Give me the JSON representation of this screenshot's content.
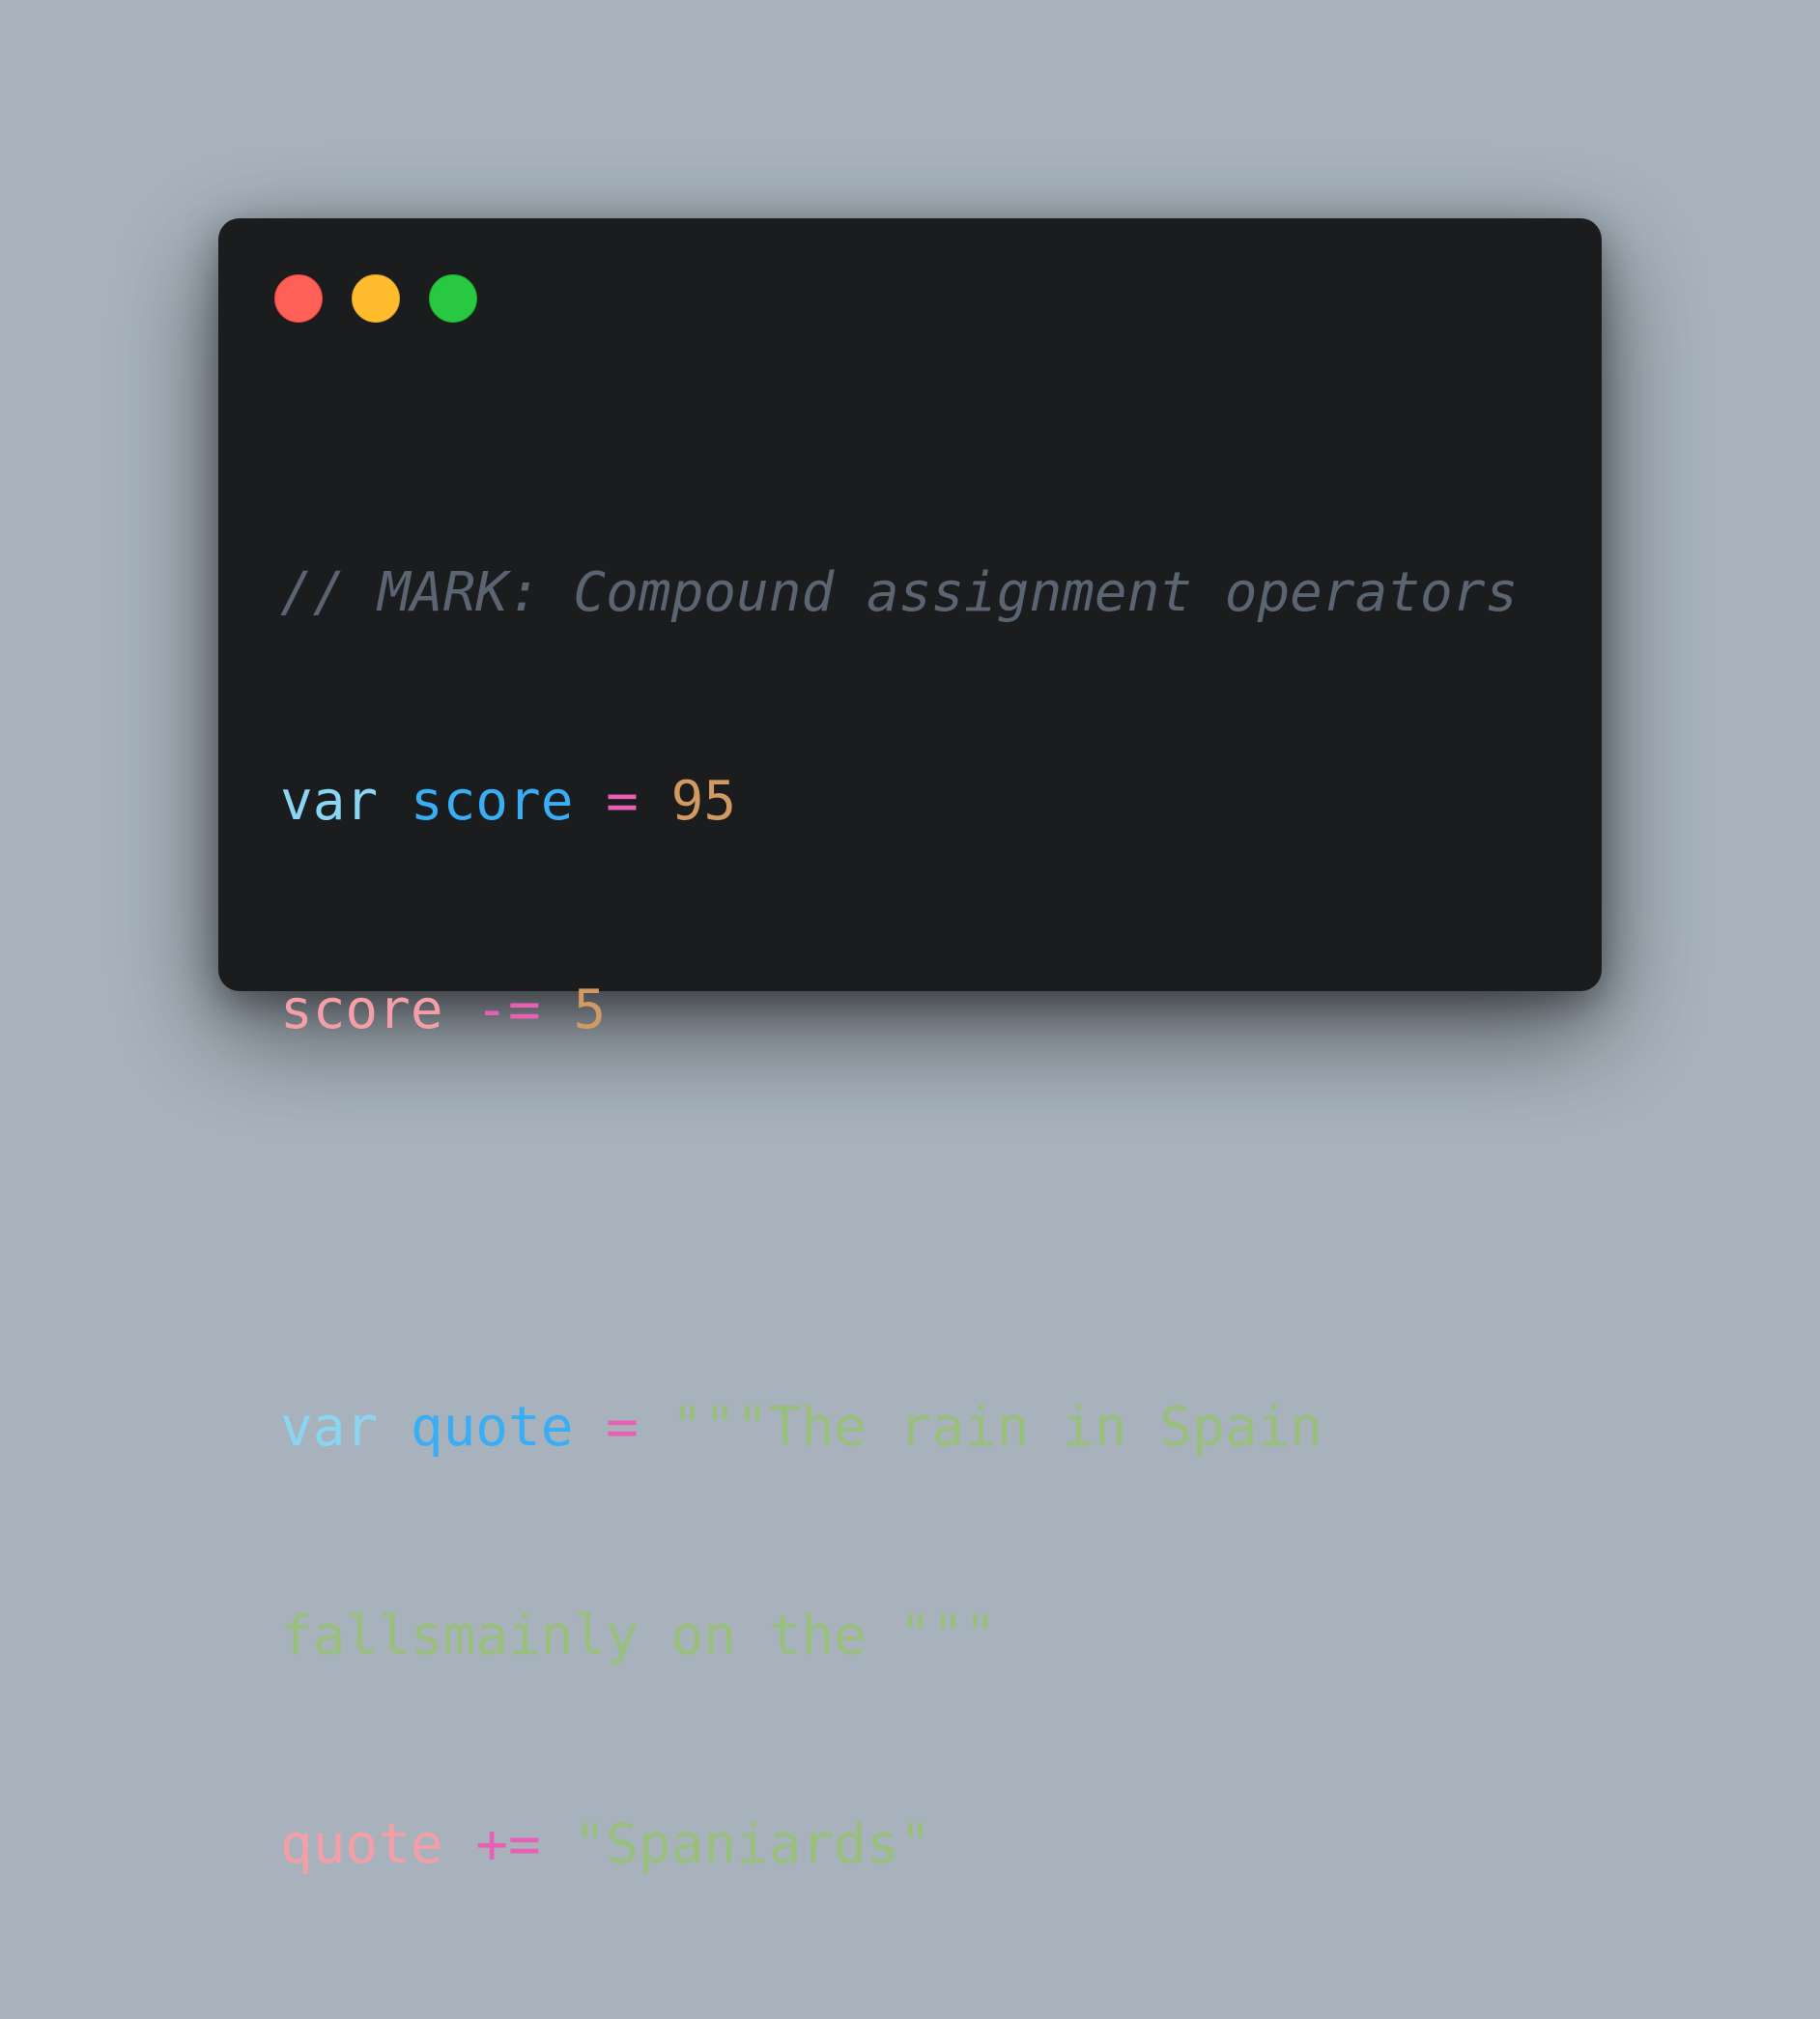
{
  "window": {
    "traffic_lights": [
      {
        "name": "close",
        "color": "#fe5f57"
      },
      {
        "name": "minimize",
        "color": "#febc2e"
      },
      {
        "name": "zoom",
        "color": "#28c840"
      }
    ]
  },
  "code": {
    "lines": [
      {
        "comment": "// MARK: Compound assignment operators"
      },
      {
        "kw": "var",
        "ident": "score",
        "op": "=",
        "num": "95"
      },
      {
        "var": "score",
        "op": "-=",
        "num": "5"
      },
      {},
      {
        "kw": "var",
        "ident": "quote",
        "op": "=",
        "str": "\"\"\"The rain in Spain"
      },
      {
        "str": "fallsmainly on the \"\"\""
      },
      {
        "var": "quote",
        "op": "+=",
        "str": "\"Spaniards\""
      }
    ]
  }
}
